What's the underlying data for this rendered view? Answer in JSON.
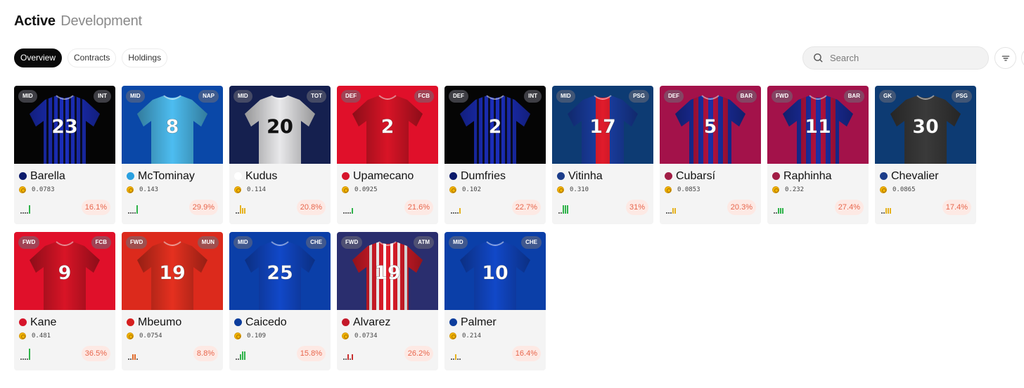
{
  "header": {
    "title_primary": "Active",
    "title_secondary": "Development"
  },
  "tabs": [
    {
      "label": "Overview",
      "active": true
    },
    {
      "label": "Contracts",
      "active": false
    },
    {
      "label": "Holdings",
      "active": false
    }
  ],
  "search": {
    "placeholder": "Search",
    "value": "",
    "icon": "search-icon"
  },
  "filter": {
    "icon": "filter-icon"
  },
  "cards": [
    {
      "position": "MID",
      "team": "INT",
      "number": "23",
      "name": "Barella",
      "price": "0.0783",
      "change": "16.1%",
      "bg": "#050505",
      "shirt": "#1c2fbf",
      "stripe": "#060606",
      "stripe_style": "vertical-thin",
      "num_color": "#ffffff",
      "club_dot": "#0b1a6b",
      "spark": [
        1,
        1,
        1,
        1,
        3
      ],
      "spark_color": "#2fb34a"
    },
    {
      "position": "MID",
      "team": "NAP",
      "number": "8",
      "name": "McTominay",
      "price": "0.143",
      "change": "29.9%",
      "bg": "#0a48a8",
      "shirt": "#4dbdf0",
      "stripe": "#4dbdf0",
      "stripe_style": "none",
      "num_color": "#ffffff",
      "club_dot": "#2aa0e0",
      "spark": [
        1,
        1,
        1,
        1,
        3
      ],
      "spark_color": "#2fb34a"
    },
    {
      "position": "MID",
      "team": "TOT",
      "number": "20",
      "name": "Kudus",
      "price": "0.114",
      "change": "20.8%",
      "bg": "#15204f",
      "shirt": "#e8e8ea",
      "stripe": "#e8e8ea",
      "stripe_style": "none",
      "num_color": "#111111",
      "club_dot": "#ffffff",
      "spark": [
        1,
        1,
        3,
        2,
        2
      ],
      "spark_color": "#e6b21f"
    },
    {
      "position": "DEF",
      "team": "FCB",
      "number": "2",
      "name": "Upamecano",
      "price": "0.0925",
      "change": "21.6%",
      "bg": "#e0102a",
      "shirt": "#d81426",
      "stripe": "#d81426",
      "stripe_style": "none",
      "num_color": "#ffffff",
      "club_dot": "#d6152b",
      "spark": [
        1,
        1,
        1,
        1,
        2
      ],
      "spark_color": "#2fb34a"
    },
    {
      "position": "DEF",
      "team": "INT",
      "number": "2",
      "name": "Dumfries",
      "price": "0.102",
      "change": "22.7%",
      "bg": "#050505",
      "shirt": "#1c2fbf",
      "stripe": "#060606",
      "stripe_style": "vertical-thin",
      "num_color": "#ffffff",
      "club_dot": "#0b1a6b",
      "spark": [
        1,
        1,
        1,
        1,
        2
      ],
      "spark_color": "#e6b21f"
    },
    {
      "position": "MID",
      "team": "PSG",
      "number": "17",
      "name": "Vitinha",
      "price": "0.310",
      "change": "31%",
      "bg": "#0d3b73",
      "shirt": "#1a3fa6",
      "stripe": "#e01b2b",
      "stripe_style": "center",
      "num_color": "#ffffff",
      "club_dot": "#1c3d8a",
      "spark": [
        1,
        1,
        3,
        3,
        3
      ],
      "spark_color": "#2fb34a"
    },
    {
      "position": "DEF",
      "team": "BAR",
      "number": "5",
      "name": "Cubarsí",
      "price": "0.0853",
      "change": "20.3%",
      "bg": "#a3124a",
      "shirt": "#1b2fa5",
      "stripe": "#b3123d",
      "stripe_style": "vertical-wide",
      "num_color": "#ffffff",
      "club_dot": "#a11d45",
      "spark": [
        1,
        1,
        1,
        2,
        2
      ],
      "spark_color": "#e6b21f"
    },
    {
      "position": "FWD",
      "team": "BAR",
      "number": "11",
      "name": "Raphinha",
      "price": "0.232",
      "change": "27.4%",
      "bg": "#a3124a",
      "shirt": "#1b2fa5",
      "stripe": "#b3123d",
      "stripe_style": "vertical-wide",
      "num_color": "#ffffff",
      "club_dot": "#a11d45",
      "spark": [
        1,
        1,
        2,
        2,
        2
      ],
      "spark_color": "#2fb34a"
    },
    {
      "position": "GK",
      "team": "PSG",
      "number": "30",
      "name": "Chevalier",
      "price": "0.0865",
      "change": "17.4%",
      "bg": "#0d3b73",
      "shirt": "#3a3a3a",
      "stripe": "#3a3a3a",
      "stripe_style": "none",
      "num_color": "#ffffff",
      "club_dot": "#1c3d8a",
      "spark": [
        1,
        1,
        2,
        2,
        2
      ],
      "spark_color": "#e6b21f"
    },
    {
      "position": "FWD",
      "team": "FCB",
      "number": "9",
      "name": "Kane",
      "price": "0.481",
      "change": "36.5%",
      "bg": "#e0102a",
      "shirt": "#d81426",
      "stripe": "#d81426",
      "stripe_style": "none",
      "num_color": "#ffffff",
      "club_dot": "#d6152b",
      "spark": [
        1,
        1,
        1,
        1,
        4
      ],
      "spark_color": "#2fb34a"
    },
    {
      "position": "FWD",
      "team": "MUN",
      "number": "19",
      "name": "Mbeumo",
      "price": "0.0754",
      "change": "8.8%",
      "bg": "#dc2a1c",
      "shirt": "#e5301f",
      "stripe": "#e5301f",
      "stripe_style": "none",
      "num_color": "#ffffff",
      "club_dot": "#d61f1f",
      "spark": [
        1,
        1,
        2,
        2,
        1
      ],
      "spark_color": "#e06a2a"
    },
    {
      "position": "MID",
      "team": "CHE",
      "number": "25",
      "name": "Caicedo",
      "price": "0.109",
      "change": "15.8%",
      "bg": "#0b3fa8",
      "shirt": "#1148c8",
      "stripe": "#1148c8",
      "stripe_style": "none",
      "num_color": "#ffffff",
      "club_dot": "#0d3d9c",
      "spark": [
        1,
        1,
        2,
        3,
        3
      ],
      "spark_color": "#2fb34a"
    },
    {
      "position": "FWD",
      "team": "ATM",
      "number": "19",
      "name": "Alvarez",
      "price": "0.0734",
      "change": "26.2%",
      "bg": "#2a2e6e",
      "shirt": "#e01d2a",
      "stripe": "#ffffff",
      "stripe_style": "vertical-red-white",
      "num_color": "#ffffff",
      "club_dot": "#c4192a",
      "spark": [
        1,
        1,
        2,
        1,
        2
      ],
      "spark_color": "#c93030"
    },
    {
      "position": "MID",
      "team": "CHE",
      "number": "10",
      "name": "Palmer",
      "price": "0.214",
      "change": "16.4%",
      "bg": "#0b3fa8",
      "shirt": "#1148c8",
      "stripe": "#1148c8",
      "stripe_style": "none",
      "num_color": "#ffffff",
      "club_dot": "#0d3d9c",
      "spark": [
        1,
        1,
        2,
        1,
        1
      ],
      "spark_color": "#e6b21f"
    }
  ]
}
